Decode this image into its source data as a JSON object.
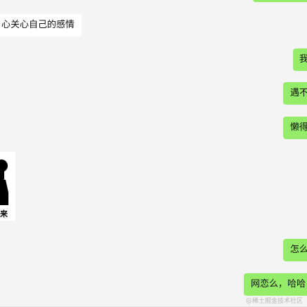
{
  "messages": [
    {
      "dir": "in",
      "text": "心关心自己的感情"
    },
    {
      "dir": "out",
      "text": "我"
    },
    {
      "dir": "out",
      "text": "遇不"
    },
    {
      "dir": "out",
      "text": "懒得"
    },
    {
      "dir": "in",
      "type": "sticker",
      "caption": "来"
    },
    {
      "dir": "out",
      "text": "怎么"
    },
    {
      "dir": "out",
      "text": "网恋么，哈哈"
    }
  ],
  "watermark": "@稀土掘金技术社区",
  "colors": {
    "background": "#f4f4f4",
    "incoming_bubble": "#ffffff",
    "outgoing_bubble": "#95ec69"
  }
}
